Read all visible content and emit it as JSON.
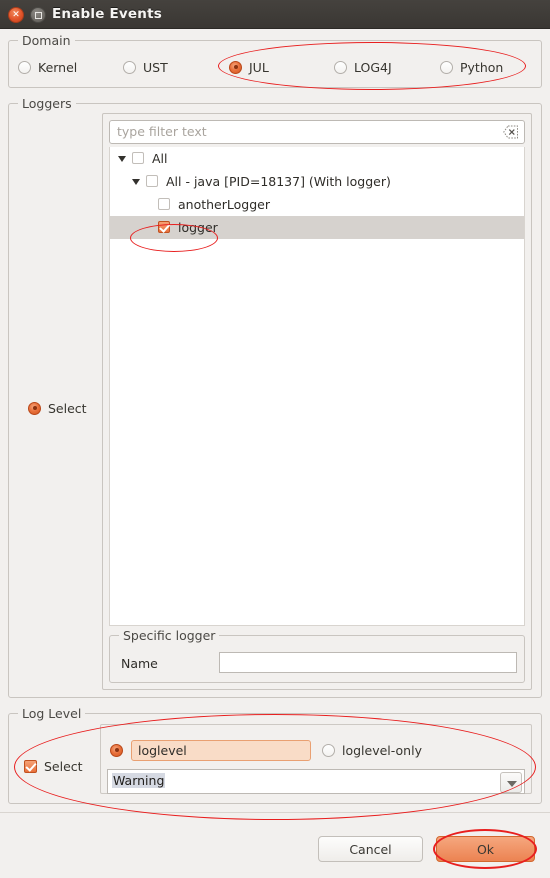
{
  "window": {
    "title": "Enable Events",
    "close_icon": "close-icon",
    "maximize_icon": "maximize-icon"
  },
  "domain": {
    "group_title": "Domain",
    "options": [
      {
        "label": "Kernel",
        "selected": false
      },
      {
        "label": "UST",
        "selected": false
      },
      {
        "label": "JUL",
        "selected": true
      },
      {
        "label": "LOG4J",
        "selected": false
      },
      {
        "label": "Python",
        "selected": false
      }
    ]
  },
  "loggers": {
    "group_title": "Loggers",
    "select_label": "Select",
    "select_checked": true,
    "filter": {
      "placeholder": "type filter text",
      "value": "",
      "clear_icon": "clear-filter-icon"
    },
    "tree": [
      {
        "label": "All",
        "checked": false,
        "expanded": true,
        "depth": 0,
        "selected": false
      },
      {
        "label": "All - java [PID=18137] (With logger)",
        "checked": false,
        "expanded": true,
        "depth": 1,
        "selected": false
      },
      {
        "label": "anotherLogger",
        "checked": false,
        "expanded": null,
        "depth": 2,
        "selected": false
      },
      {
        "label": "logger",
        "checked": true,
        "expanded": null,
        "depth": 2,
        "selected": true
      }
    ],
    "specific": {
      "group_title": "Specific logger",
      "name_label": "Name",
      "name_value": ""
    }
  },
  "log_level": {
    "group_title": "Log Level",
    "select_label": "Select",
    "select_checked": true,
    "modes": [
      {
        "label": "loglevel",
        "selected": true
      },
      {
        "label": "loglevel-only",
        "selected": false
      }
    ],
    "level_value": "Warning",
    "dropdown_icon": "chevron-down-icon"
  },
  "footer": {
    "cancel_label": "Cancel",
    "ok_label": "Ok"
  },
  "colors": {
    "accent": "#e8703b",
    "annotation": "#e81f1f",
    "titlebar": "#3a3733",
    "dialog_bg": "#f2f0ee",
    "peach_field": "#f9dcc7"
  }
}
